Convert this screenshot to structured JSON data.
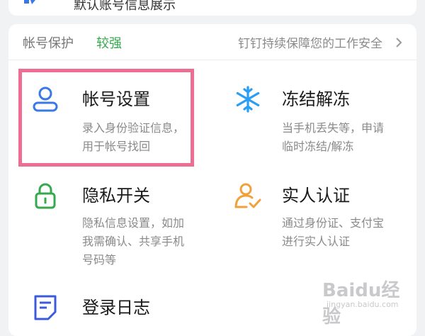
{
  "top_card": {
    "text": "默认账号信息展示"
  },
  "header": {
    "title": "帐号保护",
    "level": "较强",
    "description": "钉钉持续保障您的工作安全"
  },
  "tiles": [
    {
      "title": "帐号设置",
      "desc_line1": "录入身份验证信息，",
      "desc_line2": "用于帐号找回",
      "desc_line3": ""
    },
    {
      "title": "冻结解冻",
      "desc_line1": "当手机丢失等，申请",
      "desc_line2": "临时冻结/解冻",
      "desc_line3": ""
    },
    {
      "title": "隐私开关",
      "desc_line1": "隐私信息设置，如加",
      "desc_line2": "我需确认、共享手机",
      "desc_line3": "号码等"
    },
    {
      "title": "实人认证",
      "desc_line1": "通过身份证、支付宝",
      "desc_line2": "进行实人认证",
      "desc_line3": ""
    },
    {
      "title": "登录日志",
      "desc_line1": "",
      "desc_line2": "",
      "desc_line3": ""
    }
  ],
  "watermark": {
    "logo": "Baidu经验",
    "sub": "jingyan.baidu.com"
  },
  "colors": {
    "accent_blue": "#3b78e7",
    "green": "#36a84d",
    "orange": "#f2a13a",
    "snow_blue": "#2a9df4",
    "highlight": "#ec6e93"
  },
  "icons": {
    "top": "shield-icon",
    "account_settings": "user-icon",
    "freeze": "snowflake-icon",
    "privacy": "lock-icon",
    "real_name": "user-check-icon",
    "login_log": "document-icon"
  }
}
